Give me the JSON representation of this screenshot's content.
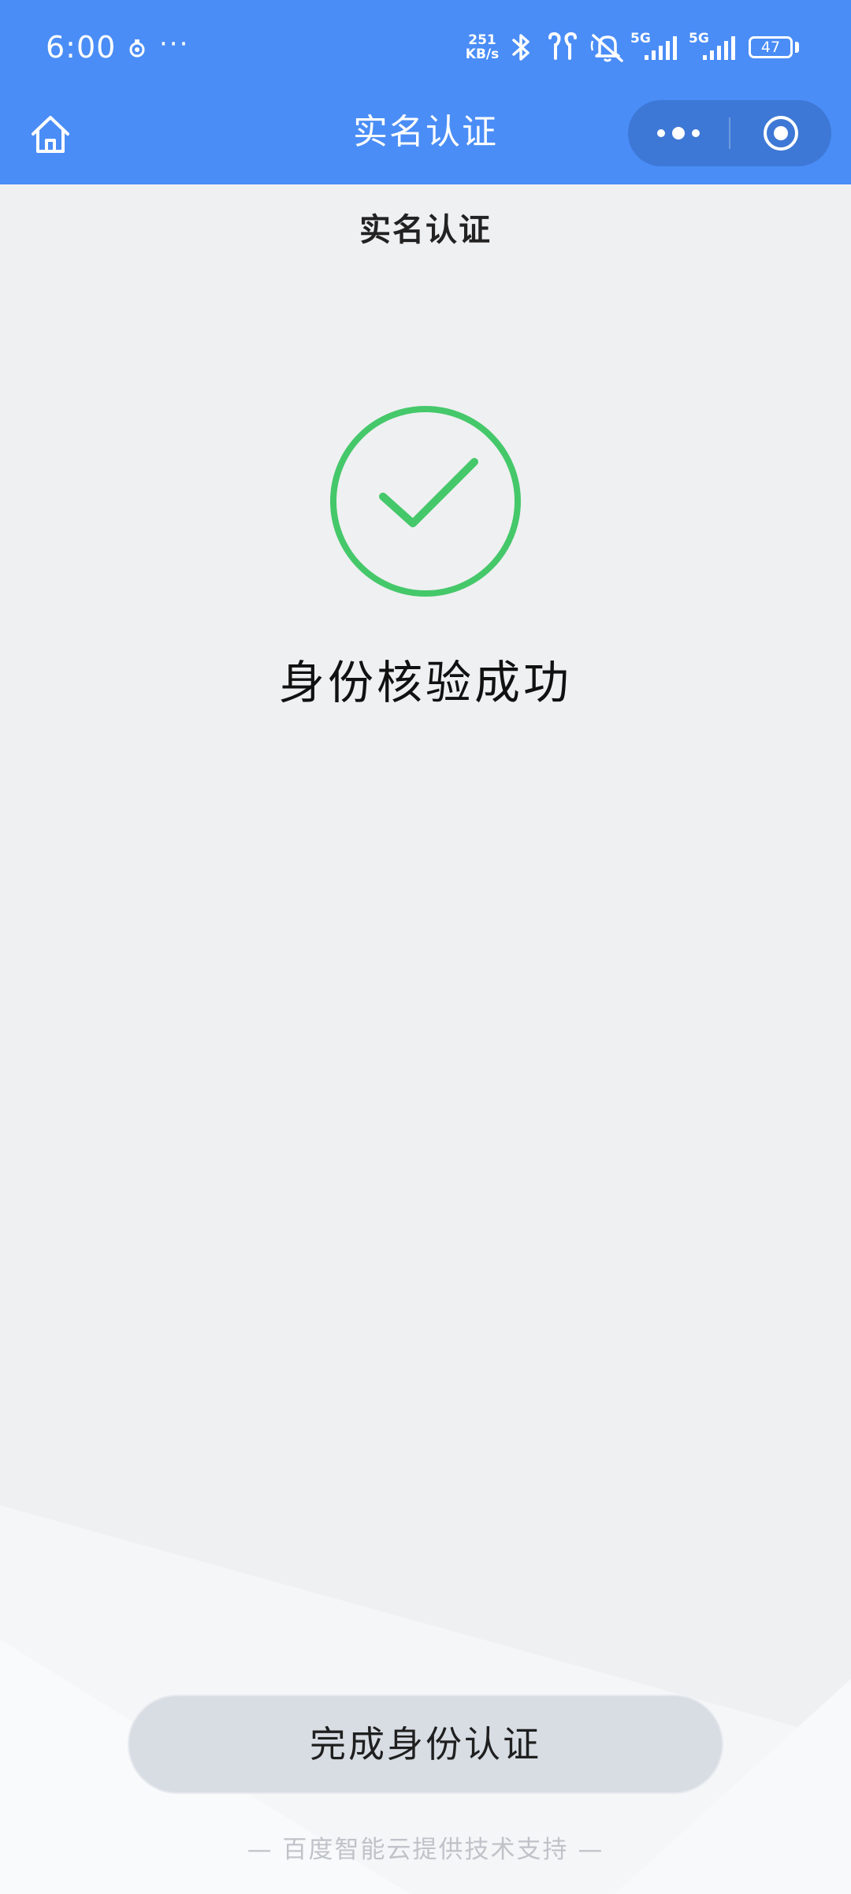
{
  "status_bar": {
    "time": "6:00",
    "overflow": "···",
    "net_speed_value": "251",
    "net_speed_unit": "KB/s",
    "signal_label_1": "5G",
    "signal_label_2": "5G",
    "battery": "47",
    "icons": [
      "app-notification-icon",
      "bluetooth-icon",
      "earbuds-icon",
      "muted-bell-icon",
      "signal-icon",
      "signal-icon",
      "battery-icon"
    ]
  },
  "nav": {
    "title": "实名认证",
    "home_icon": "home-icon",
    "more_icon": "more-dots-icon",
    "close_icon": "target-close-icon"
  },
  "page": {
    "heading": "实名认证",
    "result_icon": "check-circle-icon",
    "result_text": "身份核验成功",
    "done_button": "完成身份认证",
    "footer": "— 百度智能云提供技术支持 —"
  },
  "colors": {
    "brand_blue": "#4a8df6",
    "capsule": "#3e78d6",
    "success_green": "#45c86a",
    "background": "#eff0f2",
    "button": "#d8dde4"
  }
}
